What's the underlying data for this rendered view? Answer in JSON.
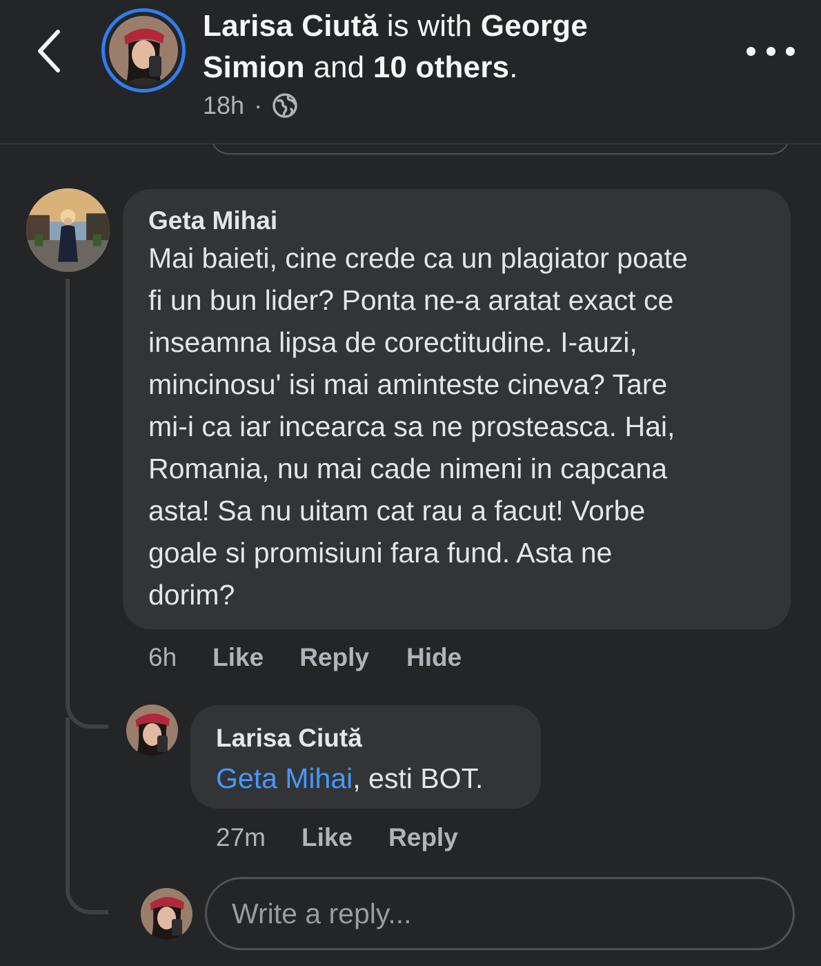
{
  "header": {
    "author": "Larisa Ciută",
    "with_text": "is with",
    "tagged_person": "George Simion",
    "and_text": "and",
    "others": "10 others",
    "time": "18h",
    "separator": "·",
    "privacy_icon": "globe-icon"
  },
  "comment": {
    "author": "Geta Mihai",
    "text": "Mai baieti, cine crede ca un plagiator poate fi un bun lider? Ponta ne-a aratat exact ce inseamna lipsa de corectitudine. I-auzi, mincinosu' isi mai aminteste cineva? Tare mi-i ca iar incearca sa ne prosteasca. Hai, Romania, nu mai cade nimeni in capcana asta! Sa nu uitam cat rau a facut! Vorbe goale si promisiuni fara fund. Asta ne dorim?",
    "lines": [
      "Mai baieti, cine crede ca un plagiator poate",
      "fi un bun lider? Ponta ne-a aratat exact ce",
      "inseamna lipsa de corectitudine. I-auzi,",
      "mincinosu' isi mai aminteste cineva? Tare",
      "mi-i ca iar incearca sa ne prosteasca. Hai,",
      "Romania, nu mai cade nimeni in capcana",
      "asta! Sa nu uitam cat rau a facut! Vorbe",
      "goale si promisiuni fara fund. Asta ne",
      "dorim?"
    ],
    "time": "6h",
    "like": "Like",
    "reply": "Reply",
    "hide": "Hide"
  },
  "reply": {
    "author": "Larisa Ciută",
    "mention": "Geta Mihai",
    "text": ", esti BOT.",
    "time": "27m",
    "like": "Like",
    "reply": "Reply"
  },
  "composer": {
    "placeholder": "Write a reply..."
  },
  "colors": {
    "background": "#242527",
    "bubble": "#333436",
    "mention": "#4599ff",
    "story_ring": "#2f7ef0"
  }
}
